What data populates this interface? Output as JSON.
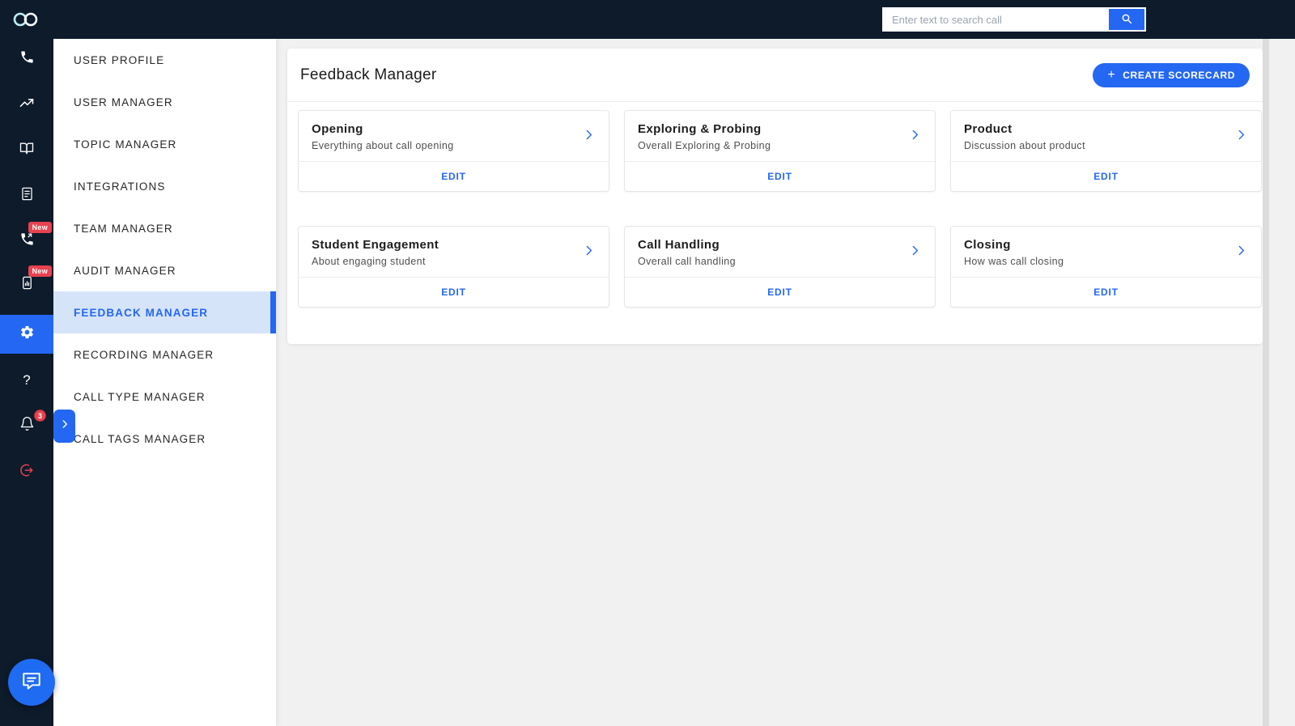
{
  "colors": {
    "accent_blue": "#2467f2",
    "topbar_navy": "#0d1b2b",
    "badge_red": "#e8414f",
    "active_item_bg": "#d6e4fa"
  },
  "topbar": {
    "logo_icon": "brand-logo",
    "search": {
      "placeholder": "Enter text to search call",
      "button_icon": "search-icon"
    }
  },
  "rail": {
    "items": [
      {
        "icon": "phone-icon"
      },
      {
        "icon": "analytics-icon"
      },
      {
        "icon": "reader-icon"
      },
      {
        "icon": "audit-doc-icon"
      },
      {
        "icon": "callback-icon",
        "badge": "New"
      },
      {
        "icon": "device-report-icon",
        "badge": "New"
      },
      {
        "icon": "settings-icon",
        "active": true
      },
      {
        "icon": "help-icon",
        "glyph": "?"
      },
      {
        "icon": "notifications-icon",
        "badge": "3"
      },
      {
        "icon": "logout-icon"
      }
    ],
    "expand_icon": "chevron-right-icon",
    "chat_fab_icon": "chat-icon"
  },
  "sidebar": {
    "items": [
      {
        "label": "USER PROFILE"
      },
      {
        "label": "USER MANAGER"
      },
      {
        "label": "TOPIC MANAGER"
      },
      {
        "label": "INTEGRATIONS"
      },
      {
        "label": "TEAM MANAGER"
      },
      {
        "label": "AUDIT MANAGER"
      },
      {
        "label": "FEEDBACK MANAGER",
        "active": true
      },
      {
        "label": "RECORDING MANAGER"
      },
      {
        "label": "CALL TYPE MANAGER"
      },
      {
        "label": "CALL TAGS MANAGER"
      }
    ]
  },
  "main": {
    "title": "Feedback Manager",
    "create_button": {
      "plus": "+",
      "label": "CREATE SCORECARD"
    },
    "cards": [
      {
        "title": "Opening",
        "subtitle": "Everything about call opening",
        "action": "EDIT"
      },
      {
        "title": "Exploring & Probing",
        "subtitle": "Overall Exploring & Probing",
        "action": "EDIT"
      },
      {
        "title": "Product",
        "subtitle": "Discussion about product",
        "action": "EDIT"
      },
      {
        "title": "Student Engagement",
        "subtitle": "About engaging student",
        "action": "EDIT"
      },
      {
        "title": "Call Handling",
        "subtitle": "Overall call handling",
        "action": "EDIT"
      },
      {
        "title": "Closing",
        "subtitle": "How was call closing",
        "action": "EDIT"
      }
    ]
  }
}
